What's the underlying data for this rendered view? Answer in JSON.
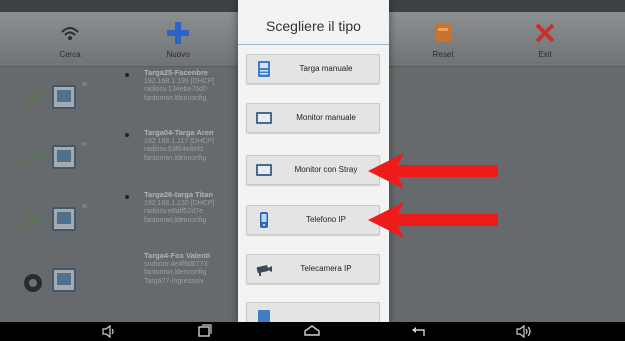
{
  "toolbar": {
    "items": [
      {
        "label": "Cerca",
        "icon": "search-wifi-icon"
      },
      {
        "label": "Nuovo",
        "icon": "plus-icon"
      },
      {
        "label": "Reset",
        "icon": "reset-icon"
      },
      {
        "label": "Exit",
        "icon": "close-icon"
      }
    ]
  },
  "devices": [
    {
      "title": "Targa25-Facenbre",
      "ip": "192.168.1.195 [DHCP]",
      "line3": "radiosv.134ebe76d0",
      "line4": "fantomwr,ldenconfig"
    },
    {
      "title": "Targa04-Targa Aren",
      "ip": "192.168.1.117 [DHCP]",
      "line3": "radiosv.53f64e8efd",
      "line4": "fantomwr,ldenconfig"
    },
    {
      "title": "Targa26-targa Titan",
      "ip": "192.168.1.130 [DHCP]",
      "line3": "radiosv.e8aff52d7e",
      "line4": "fantomwr,ldenconfig"
    },
    {
      "title": "Targa4-Fox Valenti",
      "ip": "",
      "line3": "sndtionr.4e4f6d0773",
      "line4": "fantomwr,ldenconfig",
      "line5": "Targa77-Ingressoiv"
    }
  ],
  "dialog": {
    "title": "Scegliere il tipo",
    "options": [
      {
        "label": "Targa manuale",
        "icon": "intercom-panel-icon"
      },
      {
        "label": "Monitor manuale",
        "icon": "monitor-icon"
      },
      {
        "label": "Monitor con Stray",
        "icon": "monitor-icon"
      },
      {
        "label": "Telefono IP",
        "icon": "phone-icon"
      },
      {
        "label": "Telecamera IP",
        "icon": "camera-icon"
      },
      {
        "label": "",
        "icon": "device-icon"
      }
    ]
  },
  "colors": {
    "arrow": "#ee1b1b",
    "dialog_bg": "#f3f3f3",
    "option_bg": "#e4e4e4",
    "app_bg": "#7f8384"
  },
  "nav": {
    "items": [
      "volume-down-icon",
      "recent-apps-icon",
      "home-icon",
      "back-icon",
      "volume-up-icon"
    ]
  }
}
